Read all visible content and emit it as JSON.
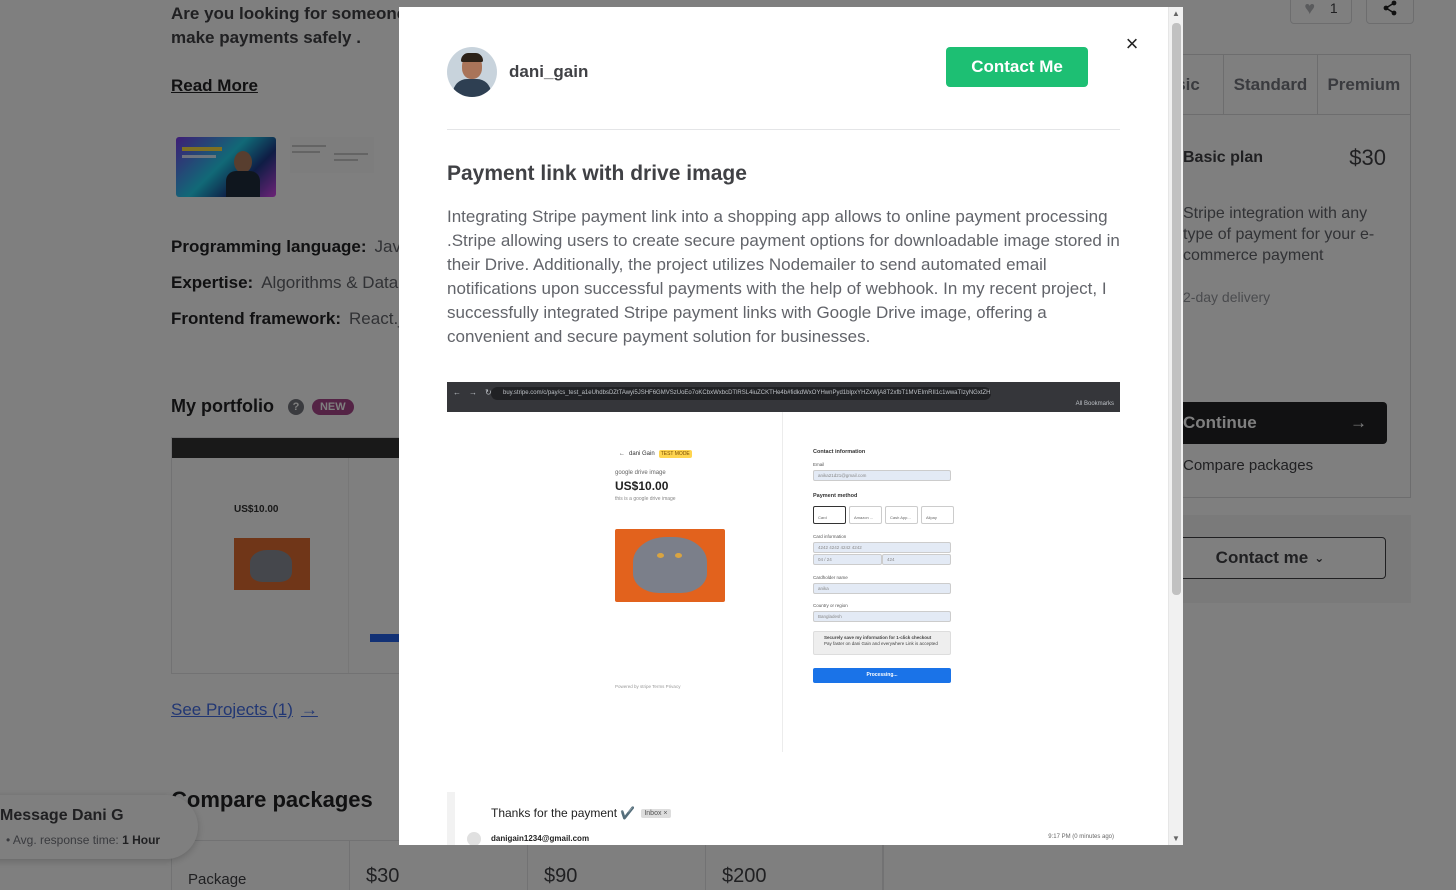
{
  "gig": {
    "intro": "Are you looking for someone who can integrate a payment gateway like stripe & also make payments safely .",
    "read_more": "Read More",
    "specs": [
      {
        "label": "Programming language:",
        "value": "JavaScript"
      },
      {
        "label": "Expertise:",
        "value": "Algorithms & Data Structures"
      },
      {
        "label": "Frontend framework:",
        "value": "React.js"
      }
    ],
    "portfolio_title": "My portfolio",
    "portfolio_badge": "NEW",
    "portfolio_help": "?",
    "portfolio_preview_price": "US$10.00",
    "see_projects": "See Projects (1)",
    "compare_title": "Compare packages",
    "compare": [
      "Package",
      "$30",
      "$90",
      "$200"
    ]
  },
  "sidebar": {
    "like_count": "1",
    "tabs": [
      "Basic",
      "Standard",
      "Premium"
    ],
    "plan": "Basic plan",
    "price": "$30",
    "desc": "Stripe integration with any type of payment for your e-commerce payment",
    "delivery": "2-day delivery",
    "continue": "Continue",
    "compare": "Compare packages",
    "contact": "Contact me"
  },
  "message": {
    "title": "Message Dani G",
    "response_label": "Avg. response time:",
    "response_value": "1 Hour"
  },
  "modal": {
    "username": "dani_gain",
    "contact_button": "Contact Me",
    "close": "×",
    "project_title": "Payment link with drive image",
    "project_desc": "Integrating Stripe payment link into a shopping app allows to online payment processing .Stripe allowing users to create secure payment options for downloadable image stored in their Drive. Additionally, the project utilizes Nodemailer to send automated email notifications upon successful payments with the help of webhook. In my recent project, I successfully integrated Stripe payment links with Google Drive image, offering a convenient and secure payment solution for businesses.",
    "screenshot": {
      "url": "buy.stripe.com/c/pay/cs_test_a1eUhdbsDZtTAwyi5JSHF6GMVSzUoEo7oKCbxWxbcDTlRSL4iuZCKTHe4b#fidkdWxOYHwnPyd1blpxYHZxWjA8T2xfbT1MVEImRII1c1wwaTIzyNGxtZHhhwND...",
      "bookmarks": "All Bookmarks",
      "merchant": "dani Gain",
      "test_badge": "TEST MODE",
      "product_name": "google drive image",
      "price": "US$10.00",
      "product_desc": "this is a google drive image",
      "powered_by": "Powered by stripe   Terms   Privacy",
      "contact_heading": "Contact information",
      "email_label": "Email",
      "email_value": "anika21d21@gmail.com",
      "payment_heading": "Payment method",
      "payment_options": [
        "Card",
        "Amazon ...",
        "Cash App...",
        "Alipay"
      ],
      "card_label": "Card information",
      "card_number": "4242 4242 4242 4242",
      "card_expiry": "04 / 24",
      "card_cvc": "424",
      "holder_label": "Cardholder name",
      "holder_value": "anika",
      "country_label": "Country or region",
      "country_value": "Bangladesh",
      "save_title": "Securely save my information for 1-click checkout",
      "save_sub": "Pay faster on dani Gain and everywhere Link is accepted",
      "processing": "Processing..."
    },
    "email_preview": {
      "subject": "Thanks for the payment ✔️",
      "tag": "Inbox ×",
      "from": "danigain1234@gmail.com",
      "time": "9:17 PM (0 minutes ago)"
    }
  }
}
